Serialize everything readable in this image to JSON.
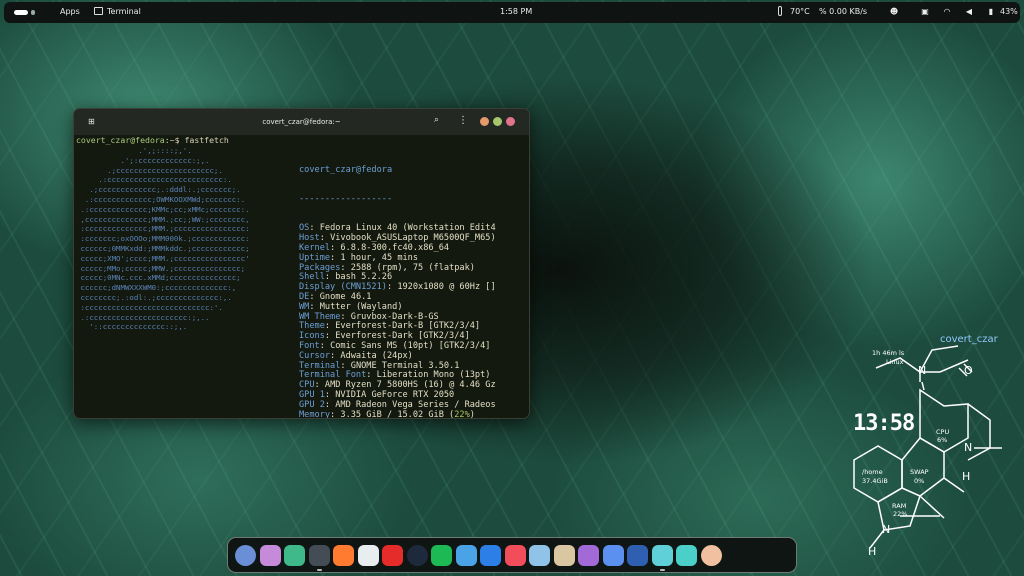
{
  "topbar": {
    "apps_label": "Apps",
    "active_app": "Terminal",
    "clock": "1:58 PM",
    "temperature": "70°C",
    "network_speed": "% 0.00 KB/s",
    "battery": "43%"
  },
  "terminal": {
    "title": "covert_czar@fedora:~",
    "prompt_user": "covert_czar@fedora",
    "prompt_path": ":~$",
    "command": "fastfetch",
    "logo_lines": [
      "              .',;::::;,'.",
      "          .';:cccccccccccc:;,.",
      "       .;cccccccccccccccccccccc;.",
      "     .:cccccccccccccccccccccccccc:.",
      "   .;ccccccccccccc;.:dddl:.;ccccccc;.",
      "  .:ccccccccccccc;OWMKOOXMWd;ccccccc:.",
      " .:ccccccccccccc;KMMc;cc;xMMc;ccccccc:.",
      " ,cccccccccccccc;MMM.;cc;;WW:;cccccccc,",
      " :cccccccccccccc;MMM.;cccccccccccccccc:",
      " :ccccccc;oxOOOo;MMM000k.;cccccccccccc:",
      " cccccc;0MMKxdd:;MMMkddc.;cccccccccccc;",
      " ccccc;XMO';cccc;MMM.;cccccccccccccccc'",
      " ccccc;MMo;ccccc;MMW.;ccccccccccccccc;",
      " ccccc;0MNc.ccc.xMMd;ccccccccccccccc;",
      " cccccc;dNMWXXXWM0:;cccccccccccccc:,",
      " cccccccc;.:odl:.;cccccccccccccc:,.",
      " :cccccccccccccccccccccccccccc:'.",
      " .:cccccccccccccccccccccc:;,..",
      "   '::cccccccccccccc::;,."
    ],
    "header_user": "covert_czar@fedora",
    "separator": "------------------",
    "info": [
      {
        "k": "OS",
        "v": " Fedora Linux 40 (Workstation Edit4"
      },
      {
        "k": "Host",
        "v": " Vivobook_ASUSLaptop M6500QF_M65)"
      },
      {
        "k": "Kernel",
        "v": " 6.8.8-300.fc40.x86_64"
      },
      {
        "k": "Uptime",
        "v": " 1 hour, 45 mins"
      },
      {
        "k": "Packages",
        "v": " 2588 (rpm), 75 (flatpak)"
      },
      {
        "k": "Shell",
        "v": " bash 5.2.26"
      },
      {
        "k": "Display (CMN1521)",
        "v": " 1920x1080 @ 60Hz []"
      },
      {
        "k": "DE",
        "v": " Gnome 46.1"
      },
      {
        "k": "WM",
        "v": " Mutter (Wayland)"
      },
      {
        "k": "WM Theme",
        "v": " Gruvbox-Dark-B-GS"
      },
      {
        "k": "Theme",
        "v": " Everforest-Dark-B [GTK2/3/4]"
      },
      {
        "k": "Icons",
        "v": " Everforest-Dark [GTK2/3/4]"
      },
      {
        "k": "Font",
        "v": " Comic Sans MS (10pt) [GTK2/3/4]"
      },
      {
        "k": "Cursor",
        "v": " Adwaita (24px)"
      },
      {
        "k": "Terminal",
        "v": " GNOME Terminal 3.50.1"
      },
      {
        "k": "Terminal Font",
        "v": " Liberation Mono (13pt)"
      },
      {
        "k": "CPU",
        "v": " AMD Ryzen 7 5800HS (16) @ 4.46 Gz"
      },
      {
        "k": "GPU 1",
        "v": " NVIDIA GeForce RTX 2050"
      },
      {
        "k": "GPU 2",
        "v": " AMD Radeon Vega Series / Radeos"
      }
    ],
    "memory": {
      "k": "Memory",
      "v": " 3.35 GiB / 15.02 GiB (",
      "pct": "22%",
      "end": ")"
    },
    "swap": {
      "k": "Swap",
      "v": " 512.00 KiB / 8.00 GiB (",
      "pct": "0%",
      "end": ")"
    },
    "disk": {
      "k": "Disk (/)",
      "v": " 37.36 GiB / 99.00 GiB (",
      "pct": "38%",
      "end": ")s"
    }
  },
  "dock": {
    "apps": [
      {
        "name": "launcher",
        "color": "#6a8fd6"
      },
      {
        "name": "app-grid",
        "color": "#c58bd9"
      },
      {
        "name": "android",
        "color": "#3fb98a"
      },
      {
        "name": "terminal",
        "color": "#444c55"
      },
      {
        "name": "firefox",
        "color": "#ff7b2f"
      },
      {
        "name": "editor",
        "color": "#e8eef0"
      },
      {
        "name": "youtube",
        "color": "#e62b2b"
      },
      {
        "name": "steam",
        "color": "#1e2a3c"
      },
      {
        "name": "spotify",
        "color": "#1db954"
      },
      {
        "name": "mail",
        "color": "#4aa3e6"
      },
      {
        "name": "tiktok",
        "color": "#2d7fe8"
      },
      {
        "name": "app-store",
        "color": "#f24d5b"
      },
      {
        "name": "files",
        "color": "#8fc3e8"
      },
      {
        "name": "photos",
        "color": "#d8c7a0"
      },
      {
        "name": "video",
        "color": "#a26ad6"
      },
      {
        "name": "settings",
        "color": "#5b8ff0"
      },
      {
        "name": "bitwarden",
        "color": "#2e5fb0"
      },
      {
        "name": "nautilus",
        "color": "#5fd0d8"
      },
      {
        "name": "calculator",
        "color": "#4ad0c8"
      },
      {
        "name": "anime",
        "color": "#f0c0a0"
      }
    ]
  },
  "widget": {
    "user": "covert_czar",
    "uptime": "1h 46m ls",
    "os": "Linux",
    "clock": "13:58",
    "cpu_label": "CPU",
    "cpu": "6%",
    "home_label": "/home",
    "home": "37.4GiB",
    "swap_label": "SWAP",
    "swap": "0%",
    "ram_label": "RAM",
    "ram": "22%",
    "h1": "H",
    "n1": "N",
    "n2": "N",
    "h2": "H",
    "o": "O"
  }
}
